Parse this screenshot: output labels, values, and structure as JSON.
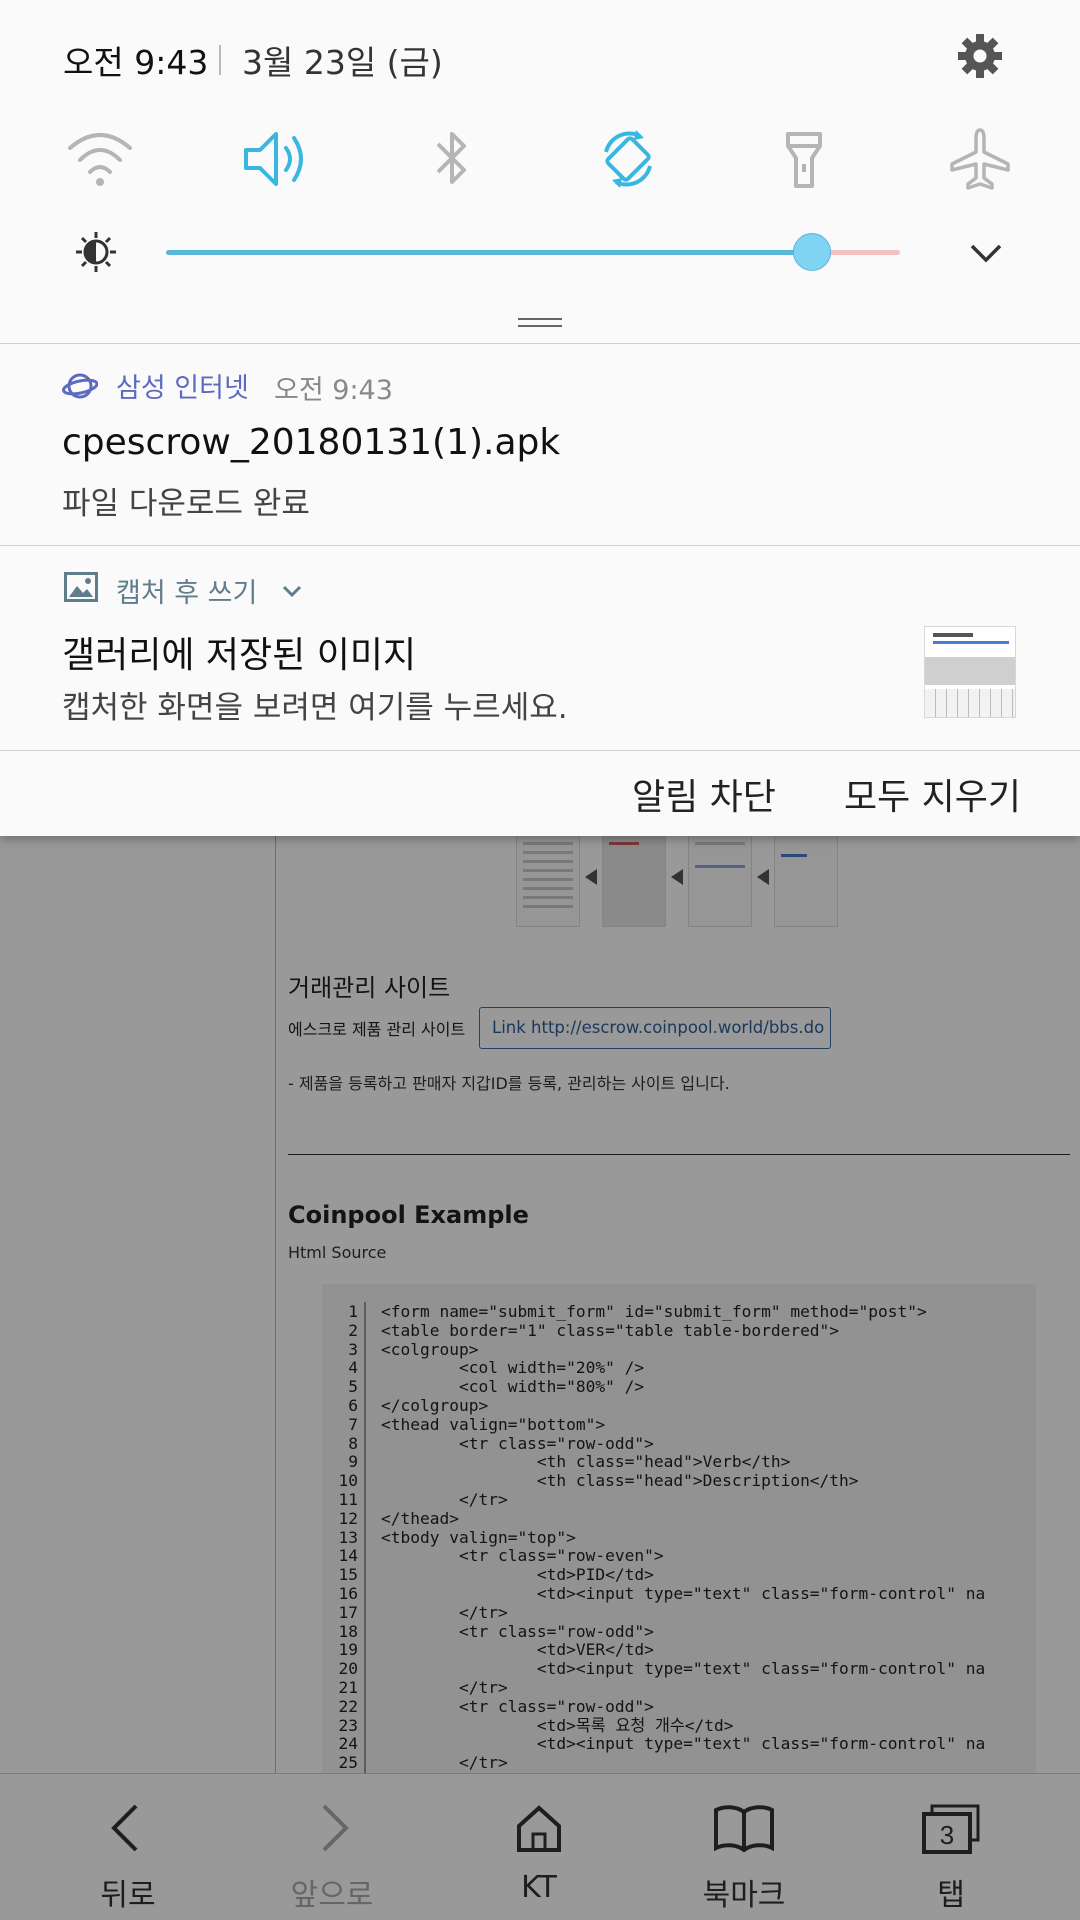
{
  "status_panel": {
    "time": "오전 9:43",
    "date": "3월 23일 (금)",
    "brightness_level": 0.88
  },
  "quick_settings": [
    {
      "name": "wifi",
      "active": false
    },
    {
      "name": "sound",
      "active": true
    },
    {
      "name": "bluetooth",
      "active": false
    },
    {
      "name": "auto-rotate",
      "active": true
    },
    {
      "name": "flashlight",
      "active": false
    },
    {
      "name": "airplane-mode",
      "active": false
    }
  ],
  "notifications": [
    {
      "app_name": "삼성 인터넷",
      "time": "오전 9:43",
      "title": "cpescrow_20180131(1).apk",
      "text": "파일 다운로드 완료",
      "app_color": "#5c6bc0"
    },
    {
      "app_name": "캡처 후 쓰기",
      "title": "갤러리에 저장된 이미지",
      "text": "캡처한 화면을 보려면 여기를 누르세요.",
      "app_color": "#607d8b"
    }
  ],
  "actions": {
    "block": "알림 차단",
    "clear_all": "모두 지우기"
  },
  "background_page": {
    "section_title": "거래관리 사이트",
    "escrow_label": "에스크로 제품 관리 사이트",
    "escrow_link": "Link http://escrow.coinpool.world/bbs.do",
    "escrow_desc": "- 제품을 등록하고 판매자 지갑ID를 등록, 관리하는 사이트 입니다.",
    "example_title": "Coinpool Example",
    "example_sub": "Html Source",
    "code_lines": [
      "<form name=\"submit_form\" id=\"submit_form\" method=\"post\">",
      "<table border=\"1\" class=\"table table-bordered\">",
      "<colgroup>",
      "        <col width=\"20%\" />",
      "        <col width=\"80%\" />",
      "</colgroup>",
      "<thead valign=\"bottom\">",
      "        <tr class=\"row-odd\">",
      "                <th class=\"head\">Verb</th>",
      "                <th class=\"head\">Description</th>",
      "        </tr>",
      "</thead>",
      "<tbody valign=\"top\">",
      "        <tr class=\"row-even\">",
      "                <td>PID</td>",
      "                <td><input type=\"text\" class=\"form-control\" na",
      "        </tr>",
      "        <tr class=\"row-odd\">",
      "                <td>VER</td>",
      "                <td><input type=\"text\" class=\"form-control\" na",
      "        </tr>",
      "        <tr class=\"row-odd\">",
      "                <td>목록 요청 개수</td>",
      "                <td><input type=\"text\" class=\"form-control\" na",
      "        </tr>"
    ]
  },
  "bottom_nav": [
    {
      "label": "뒤로",
      "icon": "back-icon",
      "enabled": true
    },
    {
      "label": "앞으로",
      "icon": "forward-icon",
      "enabled": false
    },
    {
      "label": "KT",
      "icon": "home-icon",
      "enabled": true
    },
    {
      "label": "북마크",
      "icon": "bookmark-icon",
      "enabled": true
    },
    {
      "label": "탭",
      "icon": "tabs-icon",
      "enabled": true,
      "count": "3"
    }
  ],
  "colors": {
    "accent": "#39b7e0",
    "inactive_icon": "#b5b5b5",
    "slider_fill": "#5ab7d8"
  }
}
